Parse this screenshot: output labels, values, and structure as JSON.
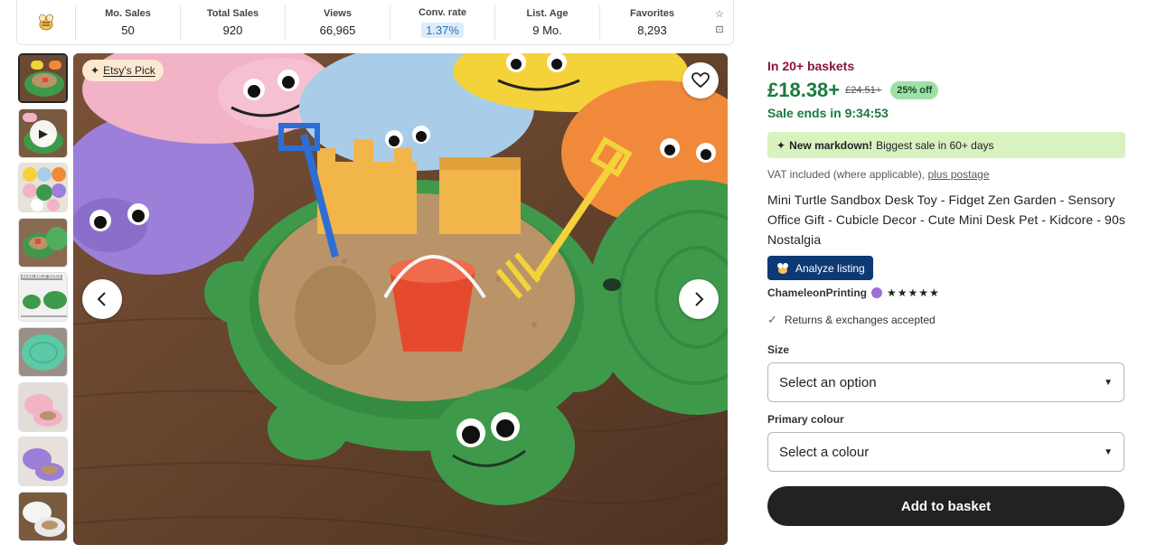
{
  "stats": {
    "logo_icon": "bee-icon",
    "items": [
      {
        "label": "Mo. Sales",
        "value": "50",
        "highlight": false
      },
      {
        "label": "Total Sales",
        "value": "920",
        "highlight": false
      },
      {
        "label": "Views",
        "value": "66,965",
        "highlight": false
      },
      {
        "label": "Conv. rate",
        "value": "1.37%",
        "highlight": true
      },
      {
        "label": "List. Age",
        "value": "9 Mo.",
        "highlight": false
      },
      {
        "label": "Favorites",
        "value": "8,293",
        "highlight": false
      }
    ],
    "action_icons": [
      "star-icon",
      "expand-icon"
    ]
  },
  "gallery": {
    "thumbnails": [
      {
        "name": "thumb-green-turtle",
        "active": true
      },
      {
        "name": "thumb-video",
        "video": true
      },
      {
        "name": "thumb-colour-variants"
      },
      {
        "name": "thumb-green-lid"
      },
      {
        "name": "thumb-available-sizes",
        "label": "AVAILABLE SIZES"
      },
      {
        "name": "thumb-teal-lid"
      },
      {
        "name": "thumb-pink-turtle"
      },
      {
        "name": "thumb-purple-turtle"
      },
      {
        "name": "thumb-white-turtle"
      }
    ],
    "badge_label": "Etsy's Pick",
    "colors": {
      "green": "#3e9a4a",
      "pink": "#f2b3c6",
      "purple": "#9b7fd9",
      "blue": "#a9cde8",
      "yellow": "#f4d23a",
      "orange": "#f08a3a",
      "sand": "#b89468",
      "wood": "#6b4a33"
    }
  },
  "listing": {
    "baskets": "In 20+ baskets",
    "price": "£18.38+",
    "original_price": "£24.51+",
    "discount": "25% off",
    "sale_ends": "Sale ends in 9:34:53",
    "markdown_bold": "New markdown!",
    "markdown_text": "Biggest sale in 60+ days",
    "vat_text": "VAT included (where applicable),",
    "vat_link": "plus postage",
    "title": "Mini Turtle Sandbox Desk Toy - Fidget Zen Garden - Sensory Office Gift - Cubicle Decor - Cute Mini Desk Pet - Kidcore - 90s Nostalgia",
    "analyze_label": "Analyze listing",
    "shop_name": "ChameleonPrinting",
    "stars": "★★★★★",
    "rating": 5,
    "returns": "Returns & exchanges accepted",
    "size_label": "Size",
    "size_value": "Select an option",
    "colour_label": "Primary colour",
    "colour_value": "Select a colour",
    "add_button": "Add to basket",
    "accent_green": "#1b7a3e",
    "accent_maroon": "#8a1538"
  }
}
